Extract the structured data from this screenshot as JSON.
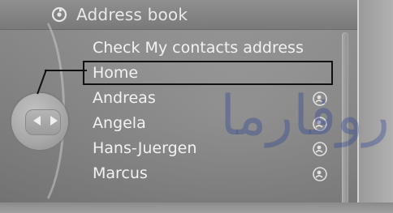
{
  "header": {
    "title": "Address book",
    "icon": "contacts-refresh-icon"
  },
  "list": {
    "items": [
      {
        "label": "Check My contacts address",
        "selected": false,
        "icon": ""
      },
      {
        "label": "Home",
        "selected": true,
        "icon": ""
      },
      {
        "label": "Andreas",
        "selected": false,
        "icon": "contact-icon"
      },
      {
        "label": "Angela",
        "selected": false,
        "icon": "contact-icon"
      },
      {
        "label": "Hans-Juergen",
        "selected": false,
        "icon": "contact-icon"
      },
      {
        "label": "Marcus",
        "selected": false,
        "icon": "contact-icon"
      }
    ]
  },
  "controller": {
    "icon": "controller-left-right-icon"
  },
  "watermark": {
    "text": "روفارما"
  },
  "colors": {
    "text": "#f2f2f2",
    "selection_border": "#111111",
    "background": "#8d8d8d",
    "watermark": "#263e96"
  }
}
